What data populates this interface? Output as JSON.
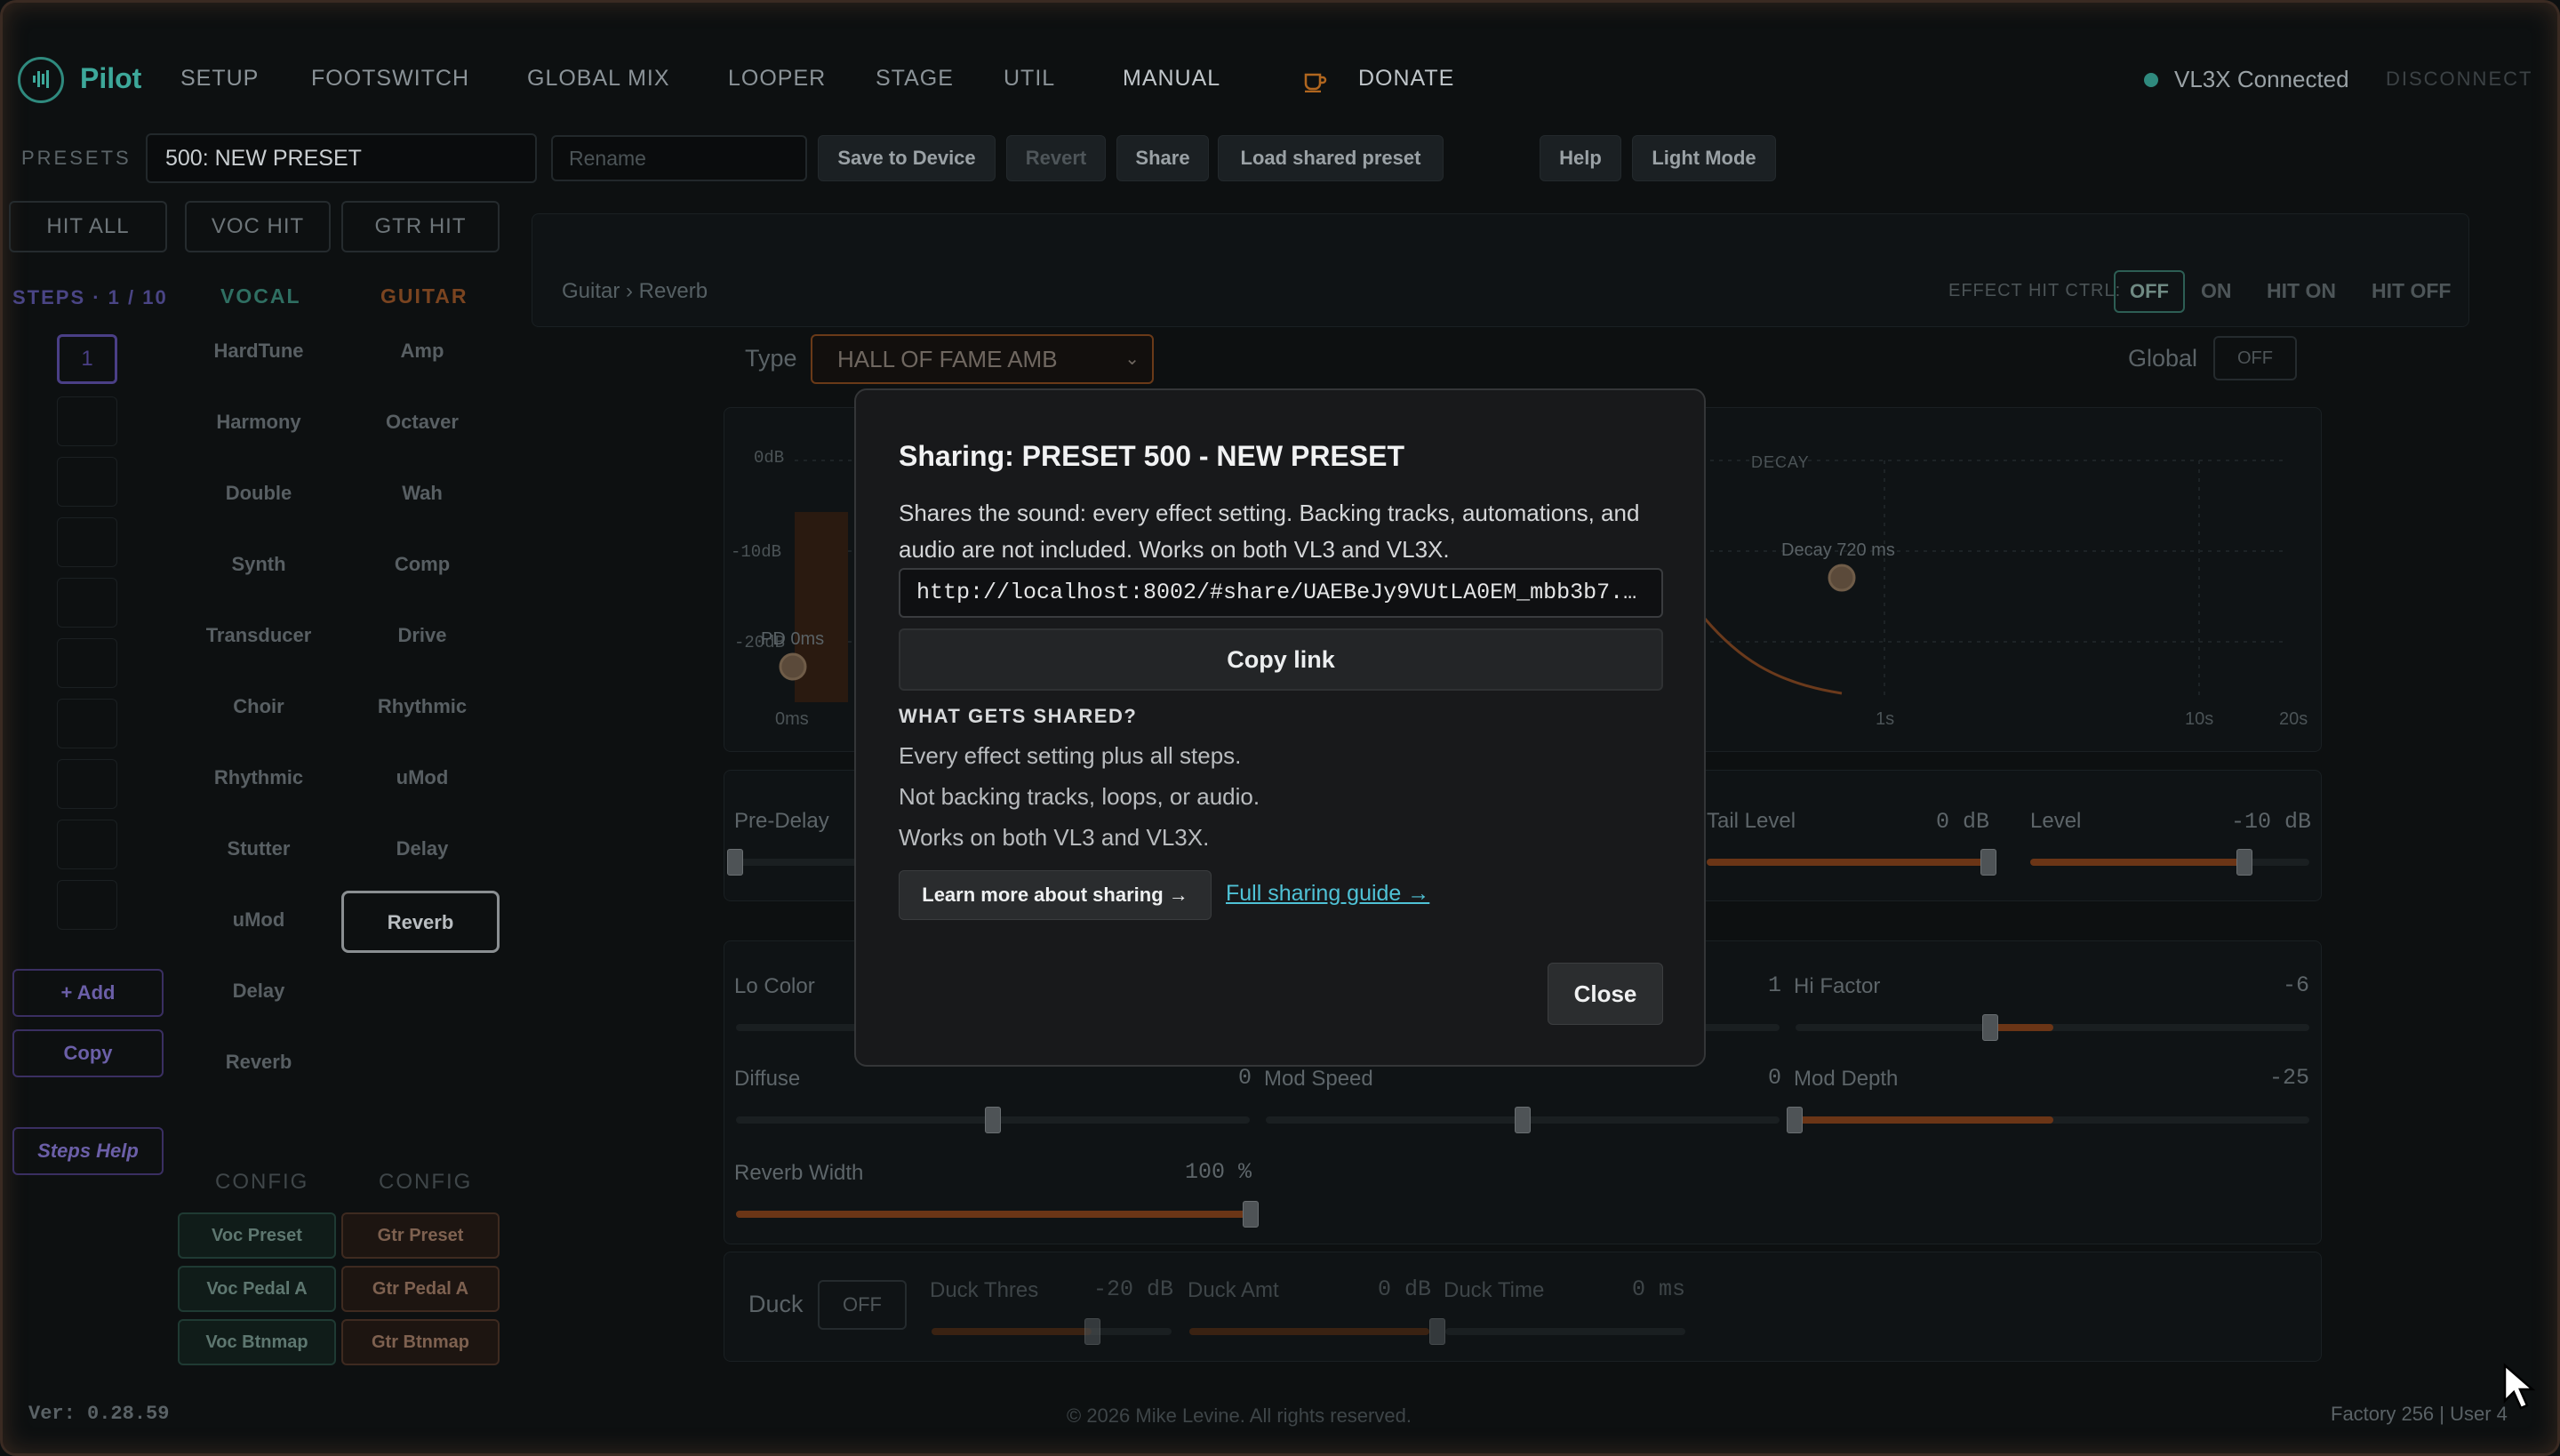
{
  "app": {
    "name": "Pilot"
  },
  "nav": {
    "items": [
      "SETUP",
      "FOOTSWITCH",
      "GLOBAL MIX",
      "LOOPER",
      "STAGE",
      "UTIL"
    ],
    "manual": "MANUAL",
    "donate": "DONATE",
    "status": "VL3X Connected",
    "disconnect": "DISCONNECT"
  },
  "presets_bar": {
    "label": "PRESETS",
    "current": "500: NEW PRESET",
    "rename_placeholder": "Rename",
    "save": "Save to Device",
    "revert": "Revert",
    "share": "Share",
    "load_shared": "Load shared preset",
    "help": "Help",
    "light_mode": "Light Mode"
  },
  "hit_buttons": [
    "HIT ALL",
    "VOC HIT",
    "GTR HIT"
  ],
  "steps": {
    "label": "STEPS · 1 / 10",
    "current": "1",
    "add": "+ Add",
    "copy": "Copy",
    "help": "Steps Help"
  },
  "vocal": {
    "header": "VOCAL",
    "effects": [
      "HardTune",
      "Harmony",
      "Double",
      "Synth",
      "Transducer",
      "Choir",
      "Rhythmic",
      "Stutter",
      "uMod",
      "Delay",
      "Reverb"
    ],
    "config_label": "CONFIG",
    "config": [
      "Voc Preset",
      "Voc Pedal A",
      "Voc Btnmap"
    ]
  },
  "guitar": {
    "header": "GUITAR",
    "effects": [
      "Amp",
      "Octaver",
      "Wah",
      "Comp",
      "Drive",
      "Rhythmic",
      "uMod",
      "Delay",
      "Reverb"
    ],
    "active": "Reverb",
    "config_label": "CONFIG",
    "config": [
      "Gtr Preset",
      "Gtr Pedal A",
      "Gtr Btnmap"
    ]
  },
  "editor": {
    "breadcrumb": "Guitar › Reverb",
    "hit_ctrl_label": "EFFECT HIT CTRL:",
    "hit_ctrl_options": [
      "OFF",
      "ON",
      "HIT ON",
      "HIT OFF"
    ],
    "type_label": "Type",
    "type_value": "HALL OF FAME AMB",
    "global_label": "Global",
    "global_value": "OFF",
    "graph": {
      "y_ticks": [
        "0dB",
        "-10dB",
        "-20dB"
      ],
      "x_ticks": [
        "0ms",
        "1s",
        "10s",
        "20s"
      ],
      "decay_label": "DECAY",
      "decay_point": "Decay 720 ms",
      "pd_point": "PD 0ms"
    },
    "params_row1": {
      "pre_delay": "Pre-Delay",
      "tail_level": "Tail Level",
      "tail_level_val": "0 dB",
      "level": "Level",
      "level_val": "-10 dB"
    },
    "params_row2": {
      "lo_color": "Lo Color",
      "hi_mid_val": "1",
      "hi_factor": "Hi Factor",
      "hi_factor_val": "-6",
      "diffuse": "Diffuse",
      "diffuse_val": "0",
      "mod_speed": "Mod Speed",
      "mod_speed_val": "0",
      "mod_depth": "Mod Depth",
      "mod_depth_val": "-25",
      "reverb_width": "Reverb Width",
      "reverb_width_val": "100 %"
    },
    "duck": {
      "label": "Duck",
      "value": "OFF",
      "thres": "Duck Thres",
      "thres_val": "-20 dB",
      "amt": "Duck Amt",
      "amt_val": "0 dB",
      "time": "Duck Time",
      "time_val": "0 ms"
    }
  },
  "footer": {
    "version": "Ver: 0.28.59",
    "copyright": "© 2026 Mike Levine. All rights reserved.",
    "right": "Factory 256 | User 4"
  },
  "modal": {
    "title": "Sharing: PRESET 500 - NEW PRESET",
    "description": "Shares the sound: every effect setting. Backing tracks, automations, and audio are not included. Works on both VL3 and VL3X.",
    "url": "http://localhost:8002/#share/UAEBeJy9VUtLA0EM_mbb3b7...",
    "copy_link": "Copy link",
    "subheading": "WHAT GETS SHARED?",
    "bullets": [
      "Every effect setting plus all steps.",
      "Not backing tracks, loops, or audio.",
      "Works on both VL3 and VL3X."
    ],
    "learn_more": "Learn more about sharing →",
    "full_guide": "Full sharing guide →",
    "close": "Close"
  },
  "colors": {
    "accent_teal": "#3da89a",
    "accent_orange": "#c76b2e",
    "accent_purple": "#6b5fa8",
    "link_cyan": "#4fc2d6"
  }
}
